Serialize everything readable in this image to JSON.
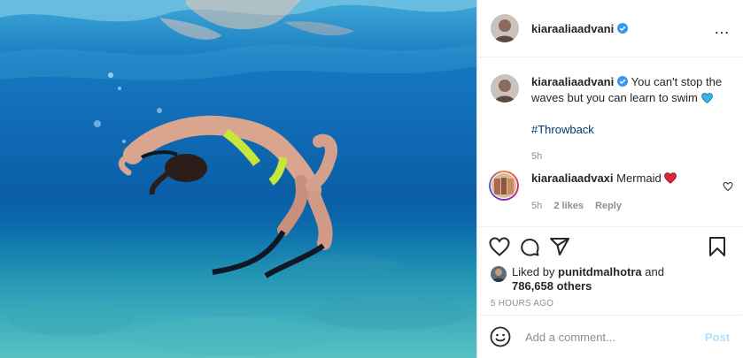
{
  "post": {
    "author": "kiaraaliaadvani",
    "verified": true,
    "more_icon": "…",
    "caption": "You can't stop the waves but you can learn to swim",
    "caption_emoji": "blue-heart",
    "hashtag": "#Throwback",
    "caption_time": "5h",
    "image_description_icon": "underwater-swimmer"
  },
  "comments": [
    {
      "user": "kiaraaliaadvaxi",
      "text": "Mermaid",
      "emoji": "red-heart",
      "time": "5h",
      "likes": "2 likes",
      "reply": "Reply"
    }
  ],
  "likes": {
    "prefix": "Liked by",
    "user": "punitdmalhotra",
    "and": "and",
    "others": "786,658 others"
  },
  "timestamp": "5 HOURS AGO",
  "add_comment": {
    "placeholder": "Add a comment...",
    "post_label": "Post"
  },
  "colors": {
    "link": "#00376b",
    "verified": "#3897f0",
    "post_button": "#b2dffc",
    "water_deep": "#0a5fa8"
  }
}
